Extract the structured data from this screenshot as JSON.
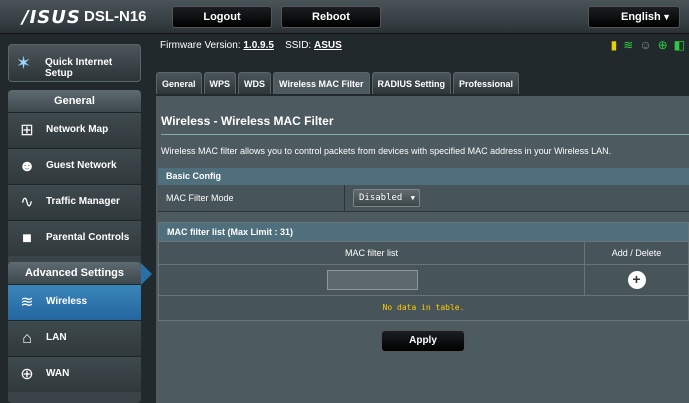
{
  "brand": {
    "logo": "/ISUS",
    "model": "DSL-N16"
  },
  "topbar": {
    "logout": "Logout",
    "reboot": "Reboot",
    "language": "English"
  },
  "sidebar": {
    "quick_setup": "Quick Internet Setup",
    "general_title": "General",
    "general_items": [
      {
        "label": "Network Map",
        "icon": "network-map-icon"
      },
      {
        "label": "Guest Network",
        "icon": "guest-network-icon"
      },
      {
        "label": "Traffic Manager",
        "icon": "traffic-manager-icon"
      },
      {
        "label": "Parental Controls",
        "icon": "lock-icon"
      }
    ],
    "advanced_title": "Advanced Settings",
    "advanced_items": [
      {
        "label": "Wireless",
        "icon": "wifi-icon",
        "active": true
      },
      {
        "label": "LAN",
        "icon": "home-icon"
      },
      {
        "label": "WAN",
        "icon": "globe-icon"
      }
    ]
  },
  "header": {
    "firmware_label": "Firmware Version:",
    "firmware_value": "1.0.9.5",
    "ssid_label": "SSID:",
    "ssid_value": "ASUS"
  },
  "tabs": [
    "General",
    "WPS",
    "WDS",
    "Wireless MAC Filter",
    "RADIUS Setting",
    "Professional"
  ],
  "active_tab": "Wireless MAC Filter",
  "page": {
    "title": "Wireless - Wireless MAC Filter",
    "description": "Wireless MAC filter allows you to control packets from devices with specified MAC address in your Wireless LAN."
  },
  "basic_config": {
    "title": "Basic Config",
    "mode_label": "MAC Filter Mode",
    "mode_value": "Disabled"
  },
  "filter_table": {
    "title": "MAC filter list (Max Limit : 31)",
    "col_list": "MAC filter list",
    "col_action": "Add / Delete",
    "input_value": "",
    "empty_text": "No data in table."
  },
  "apply_label": "Apply",
  "colors": {
    "accent": "#2466a0",
    "section": "#4f6f7c",
    "nodata": "#ffcc00"
  }
}
